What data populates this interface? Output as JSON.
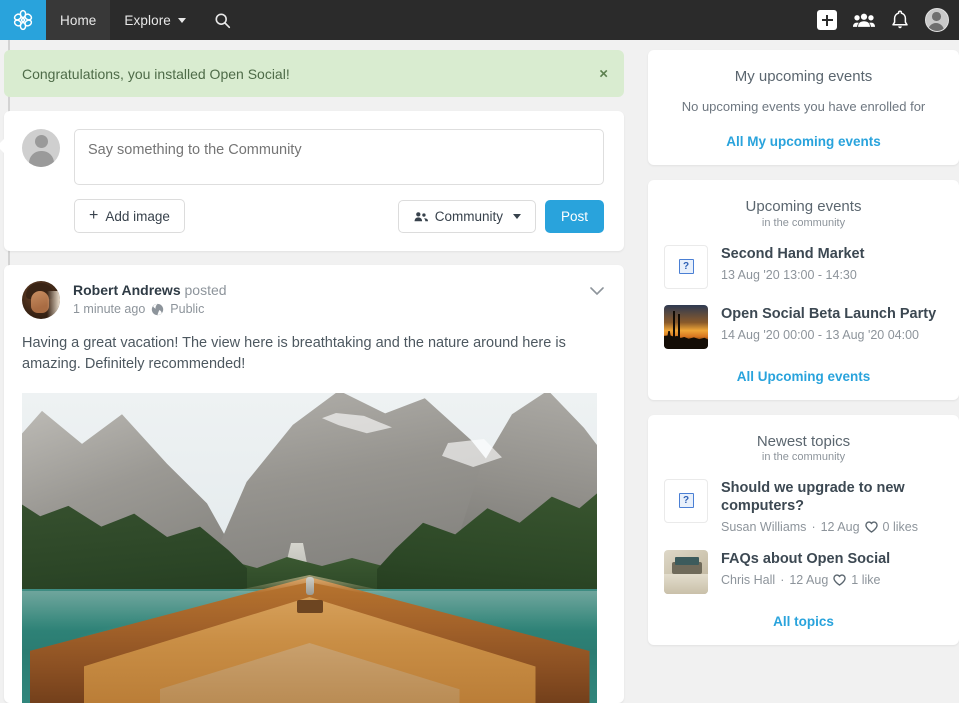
{
  "navbar": {
    "logo_icon": "flower-logo-icon",
    "logo_color": "#29a3dc",
    "items": [
      {
        "label": "Home",
        "active": true
      },
      {
        "label": "Explore",
        "active": false,
        "has_caret": true
      }
    ],
    "search_icon": "search-icon",
    "right_icons": [
      {
        "name": "add-content-icon",
        "glyph": "+"
      },
      {
        "name": "groups-icon"
      },
      {
        "name": "notifications-bell-icon"
      },
      {
        "name": "user-avatar-icon"
      }
    ]
  },
  "alert": {
    "message": "Congratulations, you installed Open Social!",
    "close_label": "×",
    "bg_color": "#d9ecd0"
  },
  "post_form": {
    "placeholder": "Say something to the Community",
    "value": "",
    "add_image_label": "Add image",
    "visibility_label": "Community",
    "post_label": "Post",
    "post_button_color": "#29a3dc"
  },
  "post": {
    "author": "Robert Andrews",
    "action": "posted",
    "time": "1 minute ago",
    "visibility": "Public",
    "body": "Having a great vacation! The view here is breathtaking and the nature around here is amazing. Definitely recommended!",
    "image_alt": "wooden-boat-on-alpine-lake"
  },
  "sidebar": {
    "my_events": {
      "title": "My upcoming events",
      "empty_text": "No upcoming events you have enrolled for",
      "link": "All My upcoming events"
    },
    "upcoming_events": {
      "title": "Upcoming events",
      "subtitle": "in the community",
      "items": [
        {
          "title": "Second Hand Market",
          "meta": "13 Aug '20 13:00 - 14:30",
          "thumb": "broken-image"
        },
        {
          "title": "Open Social Beta Launch Party",
          "meta": "14 Aug '20 00:00 - 13 Aug '20 04:00",
          "thumb": "sunset-photo"
        }
      ],
      "link": "All Upcoming events"
    },
    "newest_topics": {
      "title": "Newest topics",
      "subtitle": "in the community",
      "items": [
        {
          "title": "Should we upgrade to new computers?",
          "author": "Susan Williams",
          "date": "12 Aug",
          "likes": "0 likes",
          "thumb": "broken-image"
        },
        {
          "title": "FAQs about Open Social",
          "author": "Chris Hall",
          "date": "12 Aug",
          "likes": "1 like",
          "thumb": "room-photo"
        }
      ],
      "link": "All topics"
    }
  },
  "colors": {
    "brand_blue": "#29a3dc",
    "navbar_dark": "#2b2b2b",
    "page_bg": "#f1f1f1",
    "timeline_active": "#1e7fb0",
    "timeline_inactive": "#737373"
  }
}
